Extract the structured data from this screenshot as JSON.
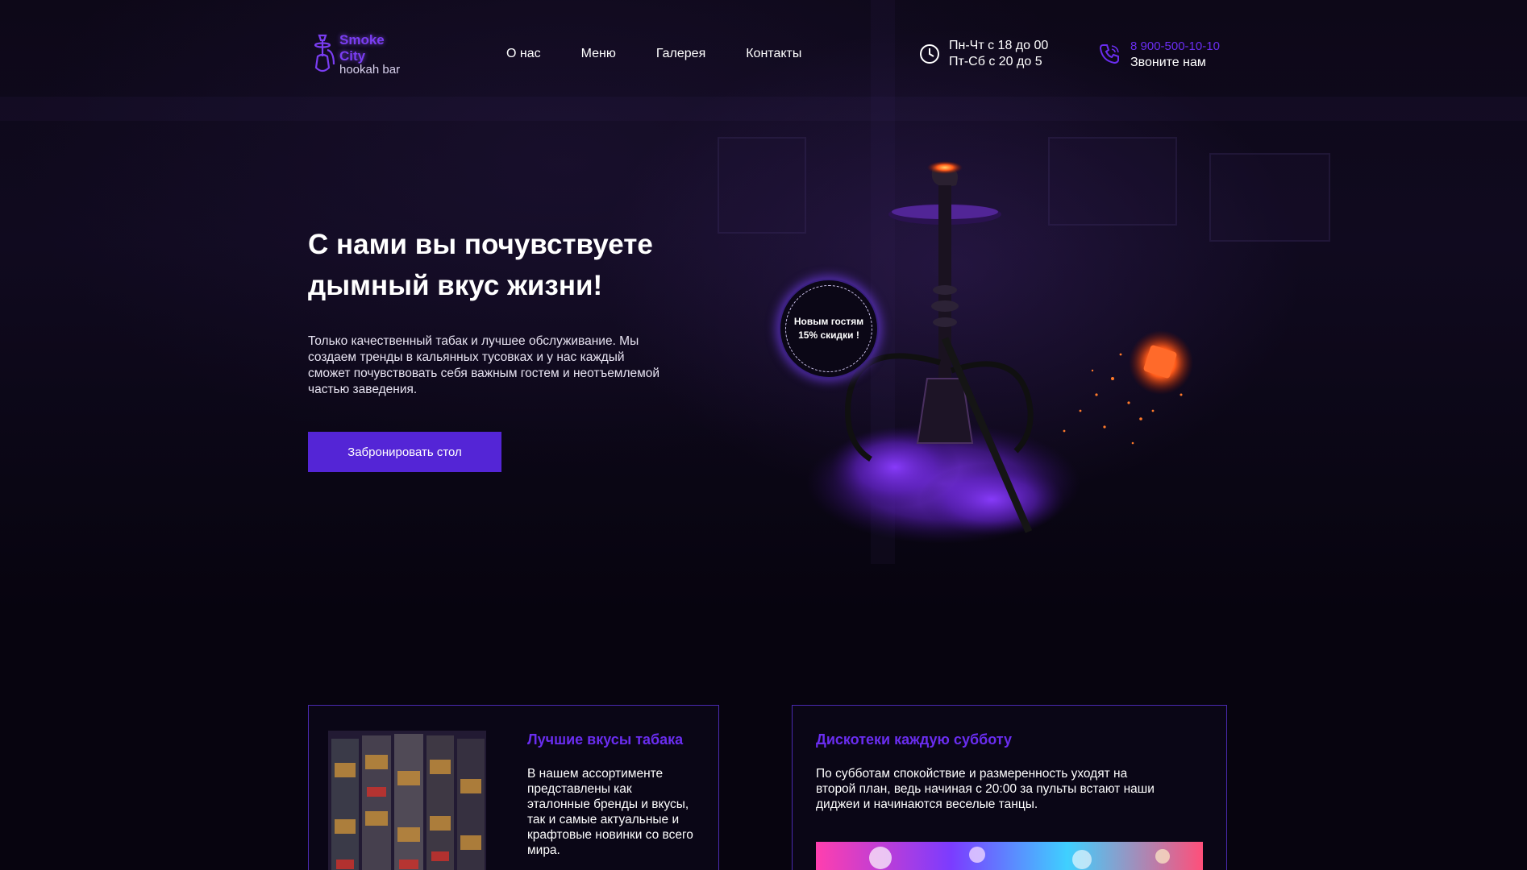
{
  "header": {
    "logo": {
      "line1": "Smoke",
      "line2": "City",
      "sub": "hookah bar"
    },
    "nav": [
      "О нас",
      "Меню",
      "Галерея",
      "Контакты"
    ],
    "hours": {
      "line1": "Пн-Чт с 18 до 00",
      "line2": "Пт-Сб с 20 до 5"
    },
    "phone": {
      "number": "8 900-500-10-10",
      "call": "Звоните нам"
    }
  },
  "hero": {
    "headline_line1": "С нами вы почувствуете",
    "headline_line2": "дымный вкус жизни!",
    "description": "Только качественный табак и лучшее обслуживание. Мы создаем тренды в кальянных тусовках и у нас каждый сможет почувствовать себя важным гостем и неотъемлемой частью заведения.",
    "button": "Забронировать стол",
    "badge_line1": "Новым гостям",
    "badge_line2": "15% скидки !"
  },
  "features": [
    {
      "title": "Лучшие вкусы табака",
      "text": "В нашем ассортименте представлены как эталонные бренды и вкусы, так и самые актуальные и крафтовые новинки со всего мира."
    },
    {
      "title": "Дискотеки каждую субботу",
      "text": "По субботам спокойствие и размеренность уходят на второй план, ведь начиная с 20:00 за пульты встают наши диджеи и начинаются веселые танцы."
    }
  ],
  "colors": {
    "accent": "#5425d6",
    "brand_purple": "#6a2df0",
    "background": "#07040f"
  }
}
